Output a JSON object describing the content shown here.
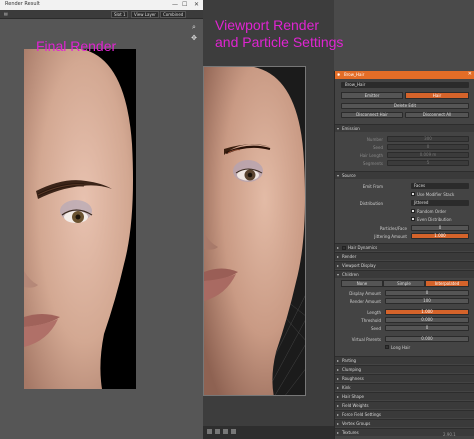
{
  "captions": {
    "left": "Final Render",
    "right_line1": "Viewport Render",
    "right_line2": "and Particle Settings"
  },
  "render_window": {
    "title": "Render Result",
    "buttons": {
      "minimize": "—",
      "maximize": "☐",
      "close": "✕"
    },
    "toolbar": {
      "slot": "Slot 1",
      "layer": "View Layer",
      "pass": "Combined"
    }
  },
  "properties": {
    "header_title": "Brow_Hair",
    "close": "✕",
    "system_name": "Brow_Hair",
    "type_tabs": [
      "Emitter",
      "Hair"
    ],
    "active_type": "Hair",
    "buttons": [
      "Delete Edit",
      "Disconnect Hair",
      "Disconnect All"
    ],
    "sections": {
      "emission": "Emission",
      "source": "Source",
      "hair_dynamics": "Hair Dynamics",
      "render": "Render",
      "viewport_display": "Viewport Display",
      "children": "Children",
      "parting": "Parting",
      "clumping": "Clumping",
      "roughness": "Roughness",
      "kink": "Kink",
      "hair_shape": "Hair Shape",
      "field_weights": "Field Weights",
      "force_field_settings": "Force Field Settings",
      "vertex_groups": "Vertex Groups",
      "textures": "Textures"
    },
    "emission_fields": [
      {
        "label": "Number",
        "value": "300"
      },
      {
        "label": "Seed",
        "value": "0"
      },
      {
        "label": "Hair Length",
        "value": "0.009 m"
      },
      {
        "label": "Segments",
        "value": "5"
      }
    ],
    "source": {
      "emit_from_label": "Emit From",
      "emit_from_value": "Faces",
      "use_modifier_stack": "Use Modifier Stack",
      "distribution_label": "Distribution",
      "distribution_value": "Jittered",
      "random_order": "Random Order",
      "even_distribution": "Even Distribution",
      "particles_face_label": "Particles/Face",
      "particles_face_value": "0",
      "jittering_label": "Jittering Amount",
      "jittering_value": "1.000"
    },
    "children": {
      "tabs": [
        "None",
        "Simple",
        "Interpolated"
      ],
      "active": "Interpolated",
      "fields": [
        {
          "label": "Display Amount",
          "value": "0"
        },
        {
          "label": "Render Amount",
          "value": "100"
        },
        {
          "label": "Length",
          "value": "1.000"
        },
        {
          "label": "Threshold",
          "value": "0.000"
        },
        {
          "label": "Seed",
          "value": "0"
        },
        {
          "label": "Virtual Parents",
          "value": "0.000"
        }
      ],
      "long_hair": "Long Hair"
    }
  },
  "viewport": {
    "bottom_version": "2.90.1"
  },
  "colors": {
    "caption": "#e024d2",
    "accent": "#d5632a",
    "panel_bg": "#444444"
  }
}
